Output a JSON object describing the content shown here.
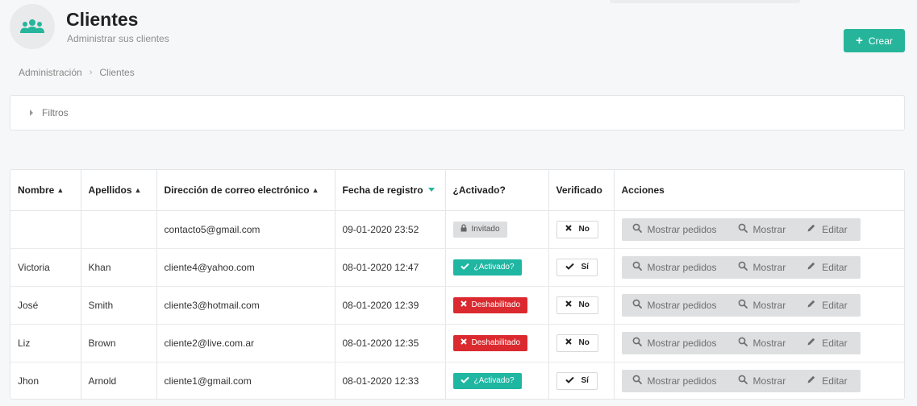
{
  "header": {
    "title": "Clientes",
    "subtitle": "Administrar sus clientes",
    "icon": "users-icon",
    "create_label": "Crear"
  },
  "breadcrumb": [
    "Administración",
    "Clientes"
  ],
  "filters": {
    "label": "Filtros"
  },
  "table": {
    "columns": [
      "Nombre",
      "Apellidos",
      "Dirección de correo electrónico",
      "Fecha de registro",
      "¿Activado?",
      "Verificado",
      "Acciones"
    ],
    "actions": [
      "Mostrar pedidos",
      "Mostrar",
      "Editar"
    ],
    "rows": [
      {
        "nombre": "",
        "apellidos": "",
        "email": "contacto5@gmail.com",
        "fecha": "09-01-2020 23:52",
        "activado": "Invitado",
        "activado_state": "invited",
        "verificado": "No"
      },
      {
        "nombre": "Victoria",
        "apellidos": "Khan",
        "email": "cliente4@yahoo.com",
        "fecha": "08-01-2020 12:47",
        "activado": "¿Activado?",
        "activado_state": "active",
        "verificado": "Sí"
      },
      {
        "nombre": "José",
        "apellidos": "Smith",
        "email": "cliente3@hotmail.com",
        "fecha": "08-01-2020 12:39",
        "activado": "Deshabilitado",
        "activado_state": "disabled",
        "verificado": "No"
      },
      {
        "nombre": "Liz",
        "apellidos": "Brown",
        "email": "cliente2@live.com.ar",
        "fecha": "08-01-2020 12:35",
        "activado": "Deshabilitado",
        "activado_state": "disabled",
        "verificado": "No"
      },
      {
        "nombre": "Jhon",
        "apellidos": "Arnold",
        "email": "cliente1@gmail.com",
        "fecha": "08-01-2020 12:33",
        "activado": "¿Activado?",
        "activado_state": "active",
        "verificado": "Sí"
      }
    ]
  },
  "colors": {
    "accent": "#26b59b",
    "active": "#1fb6a2",
    "disabled": "#db2a2f",
    "invited": "#dcdee0"
  }
}
